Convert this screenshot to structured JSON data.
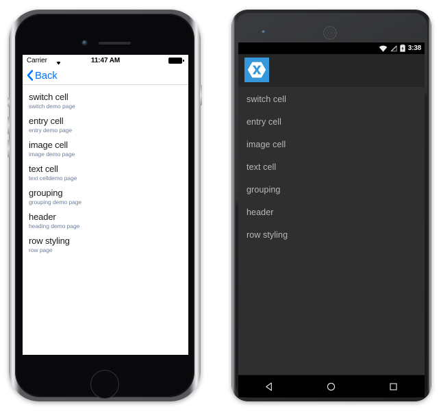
{
  "ios": {
    "status_bar": {
      "carrier": "Carrier",
      "wifi_icon": "wifi-icon",
      "time": "11:47 AM",
      "battery_icon": "battery-full-icon"
    },
    "nav_bar": {
      "back_label": "Back",
      "back_chevron_icon": "chevron-left-icon"
    },
    "list": [
      {
        "title": "switch cell",
        "detail": "switch demo page"
      },
      {
        "title": "entry cell",
        "detail": "entry demo page"
      },
      {
        "title": "image cell",
        "detail": "image demo page"
      },
      {
        "title": "text cell",
        "detail": "text celldemo page"
      },
      {
        "title": "grouping",
        "detail": "grouping demo page"
      },
      {
        "title": "header",
        "detail": "heading demo page"
      },
      {
        "title": "row styling",
        "detail": "row page"
      }
    ],
    "colors": {
      "tint": "#0076ff",
      "title": "#1a1a1a",
      "detail": "#6d7f9c",
      "background": "#ffffff"
    }
  },
  "android": {
    "status_bar": {
      "wifi_icon": "wifi-icon",
      "signal_icon": "no-signal-icon",
      "battery_icon": "battery-charging-icon",
      "clock": "3:38"
    },
    "action_bar": {
      "app_icon": "xamarin-logo-icon"
    },
    "list": [
      {
        "title": "switch cell"
      },
      {
        "title": "entry cell"
      },
      {
        "title": "image cell"
      },
      {
        "title": "text cell"
      },
      {
        "title": "grouping"
      },
      {
        "title": "header"
      },
      {
        "title": "row styling"
      }
    ],
    "nav_bar": {
      "back_icon": "back-triangle-icon",
      "home_icon": "home-circle-icon",
      "recents_icon": "recents-square-icon"
    },
    "colors": {
      "accent": "#3498db",
      "action_bar": "#262626",
      "list_background": "#2f2f2f",
      "list_text": "#b8b8b8",
      "status_bar": "#000000"
    }
  }
}
